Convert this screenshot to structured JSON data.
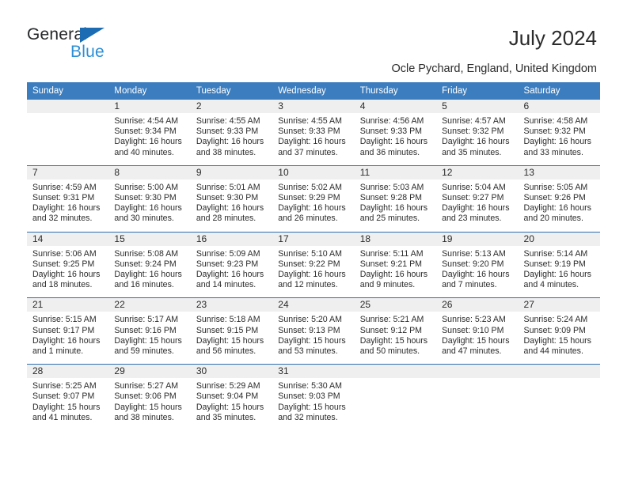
{
  "brand": {
    "name_part1": "General",
    "name_part2": "Blue",
    "triangle_icon": "blue-triangle-icon",
    "accent_color": "#1b6cb3",
    "secondary_color": "#2d8fd5"
  },
  "header": {
    "title": "July 2024",
    "subtitle": "Ocle Pychard, England, United Kingdom"
  },
  "calendar": {
    "header_bg": "#3b7dbf",
    "daynum_bg": "#efefef",
    "divider_color": "#2f6fb0",
    "weekdays": [
      "Sunday",
      "Monday",
      "Tuesday",
      "Wednesday",
      "Thursday",
      "Friday",
      "Saturday"
    ],
    "weeks": [
      [
        {
          "day": "",
          "lines": []
        },
        {
          "day": "1",
          "lines": [
            "Sunrise: 4:54 AM",
            "Sunset: 9:34 PM",
            "Daylight: 16 hours",
            "and 40 minutes."
          ]
        },
        {
          "day": "2",
          "lines": [
            "Sunrise: 4:55 AM",
            "Sunset: 9:33 PM",
            "Daylight: 16 hours",
            "and 38 minutes."
          ]
        },
        {
          "day": "3",
          "lines": [
            "Sunrise: 4:55 AM",
            "Sunset: 9:33 PM",
            "Daylight: 16 hours",
            "and 37 minutes."
          ]
        },
        {
          "day": "4",
          "lines": [
            "Sunrise: 4:56 AM",
            "Sunset: 9:33 PM",
            "Daylight: 16 hours",
            "and 36 minutes."
          ]
        },
        {
          "day": "5",
          "lines": [
            "Sunrise: 4:57 AM",
            "Sunset: 9:32 PM",
            "Daylight: 16 hours",
            "and 35 minutes."
          ]
        },
        {
          "day": "6",
          "lines": [
            "Sunrise: 4:58 AM",
            "Sunset: 9:32 PM",
            "Daylight: 16 hours",
            "and 33 minutes."
          ]
        }
      ],
      [
        {
          "day": "7",
          "lines": [
            "Sunrise: 4:59 AM",
            "Sunset: 9:31 PM",
            "Daylight: 16 hours",
            "and 32 minutes."
          ]
        },
        {
          "day": "8",
          "lines": [
            "Sunrise: 5:00 AM",
            "Sunset: 9:30 PM",
            "Daylight: 16 hours",
            "and 30 minutes."
          ]
        },
        {
          "day": "9",
          "lines": [
            "Sunrise: 5:01 AM",
            "Sunset: 9:30 PM",
            "Daylight: 16 hours",
            "and 28 minutes."
          ]
        },
        {
          "day": "10",
          "lines": [
            "Sunrise: 5:02 AM",
            "Sunset: 9:29 PM",
            "Daylight: 16 hours",
            "and 26 minutes."
          ]
        },
        {
          "day": "11",
          "lines": [
            "Sunrise: 5:03 AM",
            "Sunset: 9:28 PM",
            "Daylight: 16 hours",
            "and 25 minutes."
          ]
        },
        {
          "day": "12",
          "lines": [
            "Sunrise: 5:04 AM",
            "Sunset: 9:27 PM",
            "Daylight: 16 hours",
            "and 23 minutes."
          ]
        },
        {
          "day": "13",
          "lines": [
            "Sunrise: 5:05 AM",
            "Sunset: 9:26 PM",
            "Daylight: 16 hours",
            "and 20 minutes."
          ]
        }
      ],
      [
        {
          "day": "14",
          "lines": [
            "Sunrise: 5:06 AM",
            "Sunset: 9:25 PM",
            "Daylight: 16 hours",
            "and 18 minutes."
          ]
        },
        {
          "day": "15",
          "lines": [
            "Sunrise: 5:08 AM",
            "Sunset: 9:24 PM",
            "Daylight: 16 hours",
            "and 16 minutes."
          ]
        },
        {
          "day": "16",
          "lines": [
            "Sunrise: 5:09 AM",
            "Sunset: 9:23 PM",
            "Daylight: 16 hours",
            "and 14 minutes."
          ]
        },
        {
          "day": "17",
          "lines": [
            "Sunrise: 5:10 AM",
            "Sunset: 9:22 PM",
            "Daylight: 16 hours",
            "and 12 minutes."
          ]
        },
        {
          "day": "18",
          "lines": [
            "Sunrise: 5:11 AM",
            "Sunset: 9:21 PM",
            "Daylight: 16 hours",
            "and 9 minutes."
          ]
        },
        {
          "day": "19",
          "lines": [
            "Sunrise: 5:13 AM",
            "Sunset: 9:20 PM",
            "Daylight: 16 hours",
            "and 7 minutes."
          ]
        },
        {
          "day": "20",
          "lines": [
            "Sunrise: 5:14 AM",
            "Sunset: 9:19 PM",
            "Daylight: 16 hours",
            "and 4 minutes."
          ]
        }
      ],
      [
        {
          "day": "21",
          "lines": [
            "Sunrise: 5:15 AM",
            "Sunset: 9:17 PM",
            "Daylight: 16 hours",
            "and 1 minute."
          ]
        },
        {
          "day": "22",
          "lines": [
            "Sunrise: 5:17 AM",
            "Sunset: 9:16 PM",
            "Daylight: 15 hours",
            "and 59 minutes."
          ]
        },
        {
          "day": "23",
          "lines": [
            "Sunrise: 5:18 AM",
            "Sunset: 9:15 PM",
            "Daylight: 15 hours",
            "and 56 minutes."
          ]
        },
        {
          "day": "24",
          "lines": [
            "Sunrise: 5:20 AM",
            "Sunset: 9:13 PM",
            "Daylight: 15 hours",
            "and 53 minutes."
          ]
        },
        {
          "day": "25",
          "lines": [
            "Sunrise: 5:21 AM",
            "Sunset: 9:12 PM",
            "Daylight: 15 hours",
            "and 50 minutes."
          ]
        },
        {
          "day": "26",
          "lines": [
            "Sunrise: 5:23 AM",
            "Sunset: 9:10 PM",
            "Daylight: 15 hours",
            "and 47 minutes."
          ]
        },
        {
          "day": "27",
          "lines": [
            "Sunrise: 5:24 AM",
            "Sunset: 9:09 PM",
            "Daylight: 15 hours",
            "and 44 minutes."
          ]
        }
      ],
      [
        {
          "day": "28",
          "lines": [
            "Sunrise: 5:25 AM",
            "Sunset: 9:07 PM",
            "Daylight: 15 hours",
            "and 41 minutes."
          ]
        },
        {
          "day": "29",
          "lines": [
            "Sunrise: 5:27 AM",
            "Sunset: 9:06 PM",
            "Daylight: 15 hours",
            "and 38 minutes."
          ]
        },
        {
          "day": "30",
          "lines": [
            "Sunrise: 5:29 AM",
            "Sunset: 9:04 PM",
            "Daylight: 15 hours",
            "and 35 minutes."
          ]
        },
        {
          "day": "31",
          "lines": [
            "Sunrise: 5:30 AM",
            "Sunset: 9:03 PM",
            "Daylight: 15 hours",
            "and 32 minutes."
          ]
        },
        {
          "day": "",
          "lines": []
        },
        {
          "day": "",
          "lines": []
        },
        {
          "day": "",
          "lines": []
        }
      ]
    ]
  }
}
